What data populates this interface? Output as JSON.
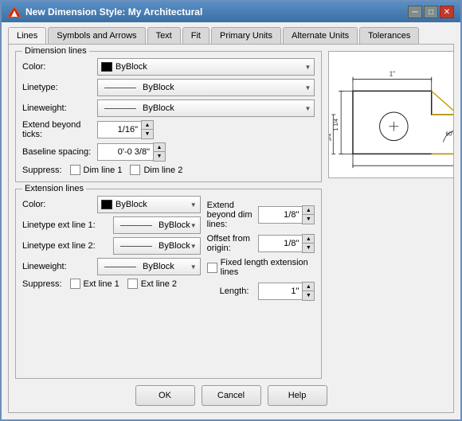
{
  "window": {
    "title": "New Dimension Style: My Architectural",
    "icon": "autocad-icon"
  },
  "tabs": [
    {
      "id": "lines",
      "label": "Lines",
      "active": true
    },
    {
      "id": "symbols",
      "label": "Symbols and Arrows"
    },
    {
      "id": "text",
      "label": "Text"
    },
    {
      "id": "fit",
      "label": "Fit"
    },
    {
      "id": "primary",
      "label": "Primary Units"
    },
    {
      "id": "alternate",
      "label": "Alternate Units"
    },
    {
      "id": "tolerances",
      "label": "Tolerances"
    }
  ],
  "dim_lines_section": {
    "label": "Dimension lines",
    "color_label": "Color:",
    "color_value": "ByBlock",
    "linetype_label": "Linetype:",
    "linetype_value": "ByBlock",
    "lineweight_label": "Lineweight:",
    "lineweight_value": "ByBlock",
    "extend_label": "Extend beyond ticks:",
    "extend_value": "1/16\"",
    "baseline_label": "Baseline spacing:",
    "baseline_value": "0'-0 3/8\"",
    "suppress_label": "Suppress:",
    "dim_line_1": "Dim line 1",
    "dim_line_2": "Dim line 2"
  },
  "ext_lines_section": {
    "label": "Extension lines",
    "color_label": "Color:",
    "color_value": "ByBlock",
    "linetype_ext1_label": "Linetype ext line 1:",
    "linetype_ext1_value": "ByBlock",
    "linetype_ext2_label": "Linetype ext line 2:",
    "linetype_ext2_value": "ByBlock",
    "lineweight_label": "Lineweight:",
    "lineweight_value": "ByBlock",
    "suppress_label": "Suppress:",
    "ext_line_1": "Ext line 1",
    "ext_line_2": "Ext line 2",
    "extend_dim_label": "Extend beyond dim lines:",
    "extend_dim_value": "1/8\"",
    "offset_label": "Offset from origin:",
    "offset_value": "1/8\"",
    "fixed_length_label": "Fixed length extension lines",
    "length_label": "Length:",
    "length_value": "1\""
  },
  "buttons": {
    "ok": "OK",
    "cancel": "Cancel",
    "help": "Help"
  }
}
